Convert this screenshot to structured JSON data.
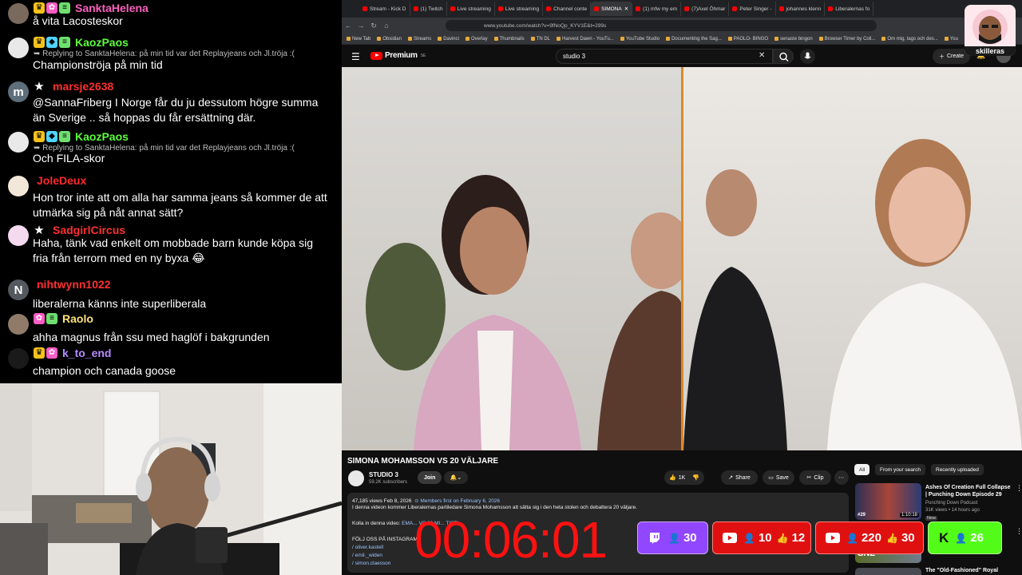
{
  "chat": {
    "messages": [
      {
        "avatar": "",
        "avatar_color": "#7a6a5e",
        "badges": [
          "crown",
          "gift",
          "sub"
        ],
        "star": false,
        "name": "SanktaHelena",
        "name_color": "#ff5fbf",
        "reply": "",
        "text": "å vita Lacosteskor"
      },
      {
        "avatar": "",
        "avatar_color": "#e9e9e9",
        "badges": [
          "crown",
          "bit",
          "sub"
        ],
        "star": false,
        "name": "KaozPaos",
        "name_color": "#5cff3a",
        "reply": "Replying to SanktaHelena: på min tid var det Replayjeans och Jl.tröja :(",
        "text": "Championströja på min tid"
      },
      {
        "avatar": "m",
        "avatar_color": "#5e6e7a",
        "badges": [],
        "star": true,
        "name": "marsje2638",
        "name_color": "#ff3030",
        "reply": "",
        "text": "@SannaFriberg I Norge får du ju dessutom högre summa än Sverige .. så hoppas du får ersättning där."
      },
      {
        "avatar": "",
        "avatar_color": "#e9e9e9",
        "badges": [
          "crown",
          "bit",
          "sub"
        ],
        "star": false,
        "name": "KaozPaos",
        "name_color": "#5cff3a",
        "reply": "Replying to SanktaHelena: på min tid var det Replayjeans och Jl.tröja :(",
        "text": "Och FILA-skor"
      },
      {
        "avatar": "",
        "avatar_color": "#f2e7d8",
        "badges": [],
        "star": false,
        "name": "JoleDeux",
        "name_color": "#ff2a2a",
        "reply": "",
        "text": "Hon tror inte att om alla har samma jeans så kommer de att utmärka sig på nåt annat sätt?"
      },
      {
        "avatar": "",
        "avatar_color": "#f5d9ef",
        "badges": [],
        "star": true,
        "name": "SadgirlCircus",
        "name_color": "#ff3030",
        "reply": "",
        "text": "Haha, tänk vad enkelt om mobbade barn kunde köpa sig fria från terrorn med en ny byxa 😂"
      },
      {
        "avatar": "N",
        "avatar_color": "#54595f",
        "badges": [],
        "star": false,
        "name": "nihtwynn1022",
        "name_color": "#ff3030",
        "reply": "",
        "text": "liberalerna känns inte superliberala"
      },
      {
        "avatar": "",
        "avatar_color": "#8f7b67",
        "badges": [
          "gift",
          "sub"
        ],
        "star": false,
        "name": "Raolo",
        "name_color": "#ffe27a",
        "reply": "",
        "text": "ahha magnus från ssu med haglöf i bakgrunden"
      },
      {
        "avatar": "",
        "avatar_color": "#1a1a1a",
        "badges": [
          "crown",
          "gift"
        ],
        "star": false,
        "name": "k_to_end",
        "name_color": "#b88cff",
        "reply": "",
        "text": "champion och canada goose"
      }
    ]
  },
  "browser": {
    "tabs": [
      "Stream - Kick D",
      "(1) Twitch",
      "Live streaming",
      "Live streaming",
      "Channel conte",
      "SIMONA",
      "(1) mfw my em",
      "(7)Axel Öhmar",
      "Peter Singer -",
      "johannes klenn",
      "Liberalernas fo"
    ],
    "active_tab": 5,
    "url": "www.youtube.com/watch?v=9fNoQp_KYV1E&t=299s",
    "bookmarks": [
      "New Tab",
      "Obsidian",
      "Streams",
      "Davinci",
      "Overlay",
      "Thumbnails",
      "TN DL",
      "Harvest Dawn - YouTu...",
      "YouTube Studio",
      "Documenting the Sag...",
      "PAOLO- BINGO",
      "senaste bingon",
      "Browser Timer by Coll...",
      "Om mig, tags och des...",
      "You"
    ]
  },
  "youtube": {
    "logo": "Premium",
    "logo_region": "SE",
    "search_query": "studio 3",
    "create_label": "Create",
    "video_title": "SIMONA MOHAMSSON VS 20 VÄLJARE",
    "channel_name": "STUDIO 3",
    "channel_subs": "59.2K subscribers",
    "join_label": "Join",
    "like_count": "1K",
    "share_label": "Share",
    "save_label": "Save",
    "clip_label": "Clip",
    "desc_meta": "47,185 views  Feb 8, 2026",
    "desc_members": "⊙ Members first on February 6, 2026",
    "desc_line1": "I denna videon kommer Liberalernas partiledare Simona Mohamsson att sätta sig i den heta stolen och debattera 20 väljare.",
    "desc_kolla": "Kolla in denna video:",
    "desc_kolla_tail": "EMA... VS 20 MI... TISTI...",
    "desc_folj": "FÖLJ OSS PÅ INSTAGRAM",
    "desc_links": [
      "/ oliver.kastell",
      "/ emil._widen",
      "/ simon.claesson"
    ]
  },
  "sidebar": {
    "chips": [
      "All",
      "From your search",
      "Recently uploaded"
    ],
    "rec1": {
      "title": "Ashes Of Creation Full Collapse | Punching Down Episode 29",
      "channel": "Punching Down Podcast",
      "meta": "31K views • 14 hours ago",
      "badge": "New",
      "duration": "1:10:18",
      "num": "#29"
    },
    "rec2": {
      "duration": "8:18",
      "thumb_text": "SNL"
    },
    "rec3": {
      "title": "The \"Old-Fashioned\" Royal"
    }
  },
  "overlay": {
    "timer": "00:06:01",
    "viewers": {
      "twitch": {
        "count": "30"
      },
      "youtube1": {
        "count": "10",
        "likes": "12"
      },
      "youtube2": {
        "count": "220",
        "likes": "30"
      },
      "kick": {
        "count": "26",
        "letter": "K"
      }
    },
    "logo_text": "skilleras"
  }
}
